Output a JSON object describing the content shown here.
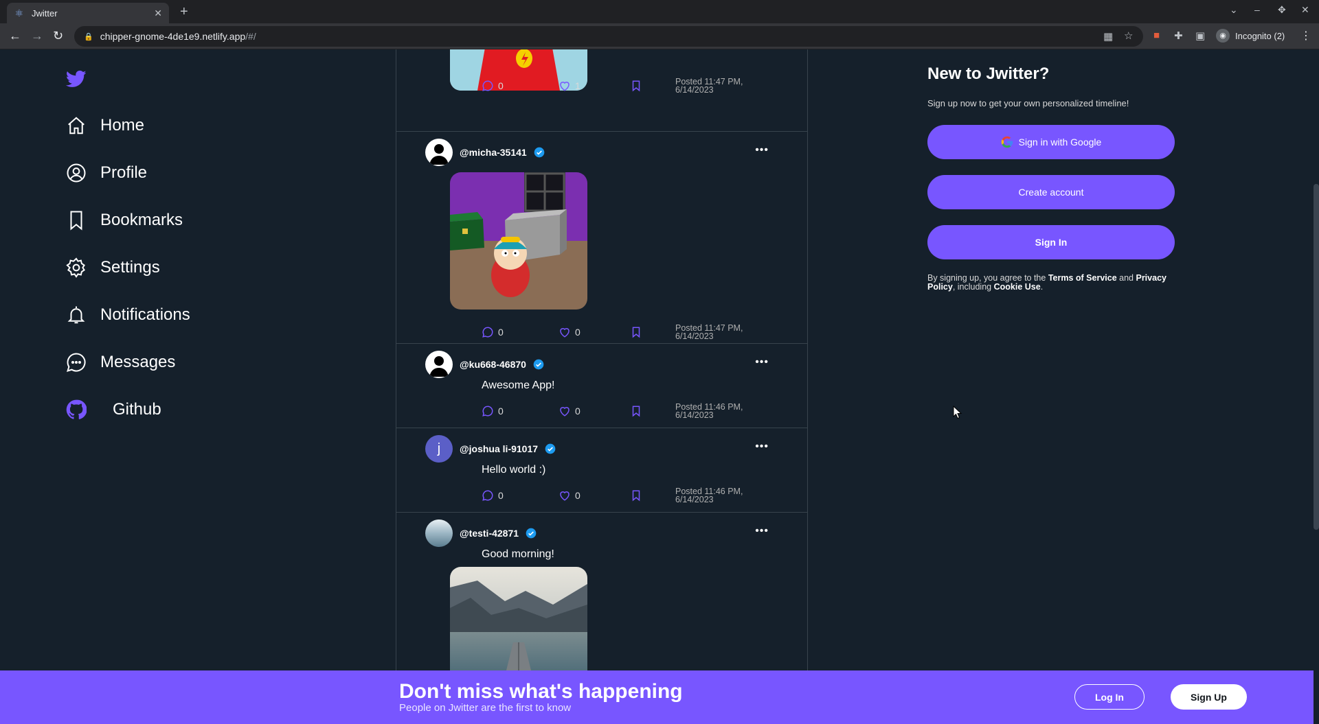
{
  "browser": {
    "tab_title": "Jwitter",
    "url_host": "chipper-gnome-4de1e9.netlify.app",
    "url_path": "/#/",
    "profile_label": "Incognito (2)"
  },
  "nav": {
    "items": [
      {
        "label": "Home",
        "icon": "home-icon"
      },
      {
        "label": "Profile",
        "icon": "profile-icon"
      },
      {
        "label": "Bookmarks",
        "icon": "bookmark-icon"
      },
      {
        "label": "Settings",
        "icon": "gear-icon"
      },
      {
        "label": "Notifications",
        "icon": "bell-icon"
      },
      {
        "label": "Messages",
        "icon": "chat-icon"
      },
      {
        "label": "Github",
        "icon": "github-icon"
      }
    ]
  },
  "feed": {
    "posts": [
      {
        "handle": "",
        "text": "",
        "image": "cartoon-character",
        "comments": "0",
        "likes": "1",
        "posted": "Posted 11:47 PM,",
        "date": "6/14/2023"
      },
      {
        "handle": "@micha-35141",
        "text": "",
        "image": "cartoon-bedroom",
        "comments": "0",
        "likes": "0",
        "posted": "Posted 11:47 PM,",
        "date": "6/14/2023"
      },
      {
        "handle": "@ku668-46870",
        "text": "Awesome App!",
        "comments": "0",
        "likes": "0",
        "posted": "Posted 11:46 PM,",
        "date": "6/14/2023"
      },
      {
        "handle": "@joshua li-91017",
        "avatar_letter": "j",
        "text": "Hello world :)",
        "comments": "0",
        "likes": "0",
        "posted": "Posted 11:46 PM,",
        "date": "6/14/2023"
      },
      {
        "handle": "@testi-42871",
        "text": "Good morning!",
        "image": "lake-mountains"
      }
    ]
  },
  "right_panel": {
    "title": "New to Jwitter?",
    "subtitle": "Sign up now to get your own personalized timeline!",
    "google_button": "Sign in with Google",
    "create_button": "Create account",
    "signin_button": "Sign In",
    "legal_prefix": "By signing up, you agree to the",
    "terms": "Terms of Service",
    "and": "and",
    "privacy": "Privacy Policy",
    "including": ", including",
    "cookie": "Cookie Use",
    "period": "."
  },
  "banner": {
    "headline": "Don't miss what's happening",
    "subline": "People on Jwitter are the first to know",
    "login_button": "Log In",
    "signup_button": "Sign Up"
  },
  "colors": {
    "accent": "#7856ff",
    "background": "#15202b",
    "verified": "#1d9bf0"
  }
}
